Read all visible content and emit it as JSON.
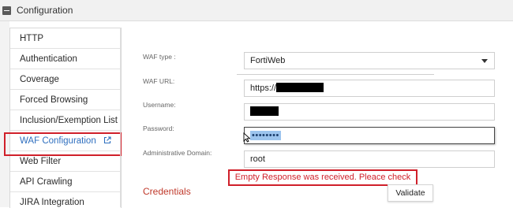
{
  "header": {
    "title": "Configuration"
  },
  "sidebar": {
    "items": [
      {
        "label": "HTTP"
      },
      {
        "label": "Authentication"
      },
      {
        "label": "Coverage"
      },
      {
        "label": "Forced Browsing"
      },
      {
        "label": "Inclusion/Exemption List"
      },
      {
        "label": "WAF Configuration",
        "active": true,
        "icon": "external-link-icon"
      },
      {
        "label": "Web Filter"
      },
      {
        "label": "API Crawling"
      },
      {
        "label": "JIRA Integration"
      }
    ]
  },
  "form": {
    "waf_type": {
      "label": "WAF type :",
      "value": "FortiWeb"
    },
    "waf_url": {
      "label": "WAF URL:",
      "value": "https://"
    },
    "username": {
      "label": "Username:",
      "value": ""
    },
    "password": {
      "label": "Password:",
      "value": "••••••••"
    },
    "admin_domain": {
      "label": "Administrative Domain:",
      "value": "root"
    }
  },
  "error_message": "Empty Response was received. Pleace check",
  "credentials_heading": "Credentials",
  "validate_label": "Validate",
  "colors": {
    "accent_blue": "#2f6fbf",
    "error_red": "#d0202a",
    "credentials_red": "#c0392b"
  }
}
